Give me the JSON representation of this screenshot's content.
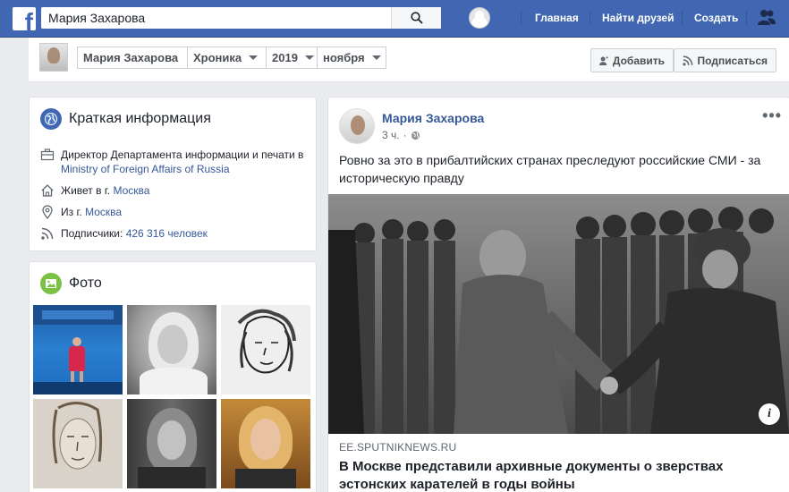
{
  "topbar": {
    "logo": "f",
    "search_value": "Мария Захарова",
    "nav": [
      "Главная",
      "Найти друзей",
      "Создать"
    ]
  },
  "subbar": {
    "crumbs": [
      "Мария Захарова",
      "Хроника",
      "2019",
      "ноября"
    ],
    "add_label": "Добавить",
    "subscribe_label": "Подписаться"
  },
  "intro": {
    "title": "Краткая информация",
    "job_prefix": "Директор Департамента информации и печати в",
    "job_org": "Ministry of Foreign Affairs of Russia",
    "lives_prefix": "Живет в г.",
    "lives_city": "Москва",
    "from_prefix": "Из г.",
    "from_city": "Москва",
    "followers_prefix": "Подписчики:",
    "followers_count": "426 316 человек"
  },
  "photos": {
    "title": "Фото"
  },
  "post": {
    "author": "Мария Захарова",
    "time": "3 ч.",
    "text": "Ровно за это в прибалтийских странах преследуют российские СМИ - за историческую правду",
    "link_domain": "EE.SPUTNIKNEWS.RU",
    "link_title": "В Москве представили архивные документы о зверствах эстонских карателей в годы войны",
    "info_badge": "i",
    "more": "•••"
  },
  "colors": {
    "brand": "#4267b2",
    "link": "#365899",
    "background": "#e9ebee"
  }
}
